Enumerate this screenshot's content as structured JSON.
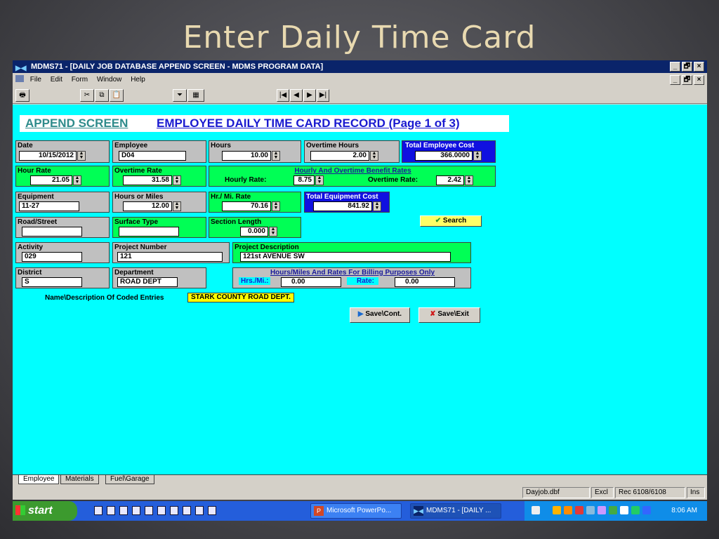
{
  "slide_title": "Enter Daily Time Card",
  "window": {
    "title": "MDMS71 - [DAILY JOB DATABASE APPEND SCREEN - MDMS PROGRAM DATA]",
    "buttons": [
      "_",
      "🗗",
      "×"
    ]
  },
  "menu": [
    "File",
    "Edit",
    "Form",
    "Window",
    "Help"
  ],
  "nav_buttons": [
    "|◀",
    "◀",
    "▶",
    "▶|"
  ],
  "header": {
    "left": "APPEND SCREEN",
    "right": "EMPLOYEE DAILY TIME CARD RECORD (Page 1 of 3)"
  },
  "fields": {
    "date": {
      "label": "Date",
      "value": "10/15/2012"
    },
    "employee": {
      "label": "Employee",
      "value": "D04"
    },
    "hours": {
      "label": "Hours",
      "value": "10.00"
    },
    "overtime_hours": {
      "label": "Overtime Hours",
      "value": "2.00"
    },
    "total_employee_cost": {
      "label": "Total Employee Cost",
      "value": "366.0000"
    },
    "hour_rate": {
      "label": "Hour Rate",
      "value": "21.05"
    },
    "overtime_rate": {
      "label": "Overtime Rate",
      "value": "31.58"
    },
    "benefit": {
      "label": "Hourly And Overtime Benefit Rates",
      "hourly_label": "Hourly Rate:",
      "hourly_value": "8.75",
      "overtime_label": "Overtime Rate:",
      "overtime_value": "2.42"
    },
    "equipment": {
      "label": "Equipment",
      "value": "11-27"
    },
    "hours_or_miles": {
      "label": "Hours or Miles",
      "value": "12.00"
    },
    "hr_mi_rate": {
      "label": "Hr./ Mi. Rate",
      "value": "70.16"
    },
    "total_equipment_cost": {
      "label": "Total Equipment Cost",
      "value": "841.92"
    },
    "road_street": {
      "label": "Road/Street",
      "value": ""
    },
    "surface_type": {
      "label": "Surface Type",
      "value": ""
    },
    "section_length": {
      "label": "Section Length",
      "value": "0.000"
    },
    "activity": {
      "label": "Activity",
      "value": "029"
    },
    "project_number": {
      "label": "Project Number",
      "value": "121"
    },
    "project_description": {
      "label": "Project Description",
      "value": "121st  AVENUE SW"
    },
    "district": {
      "label": "District",
      "value": "S"
    },
    "department": {
      "label": "Department",
      "value": "ROAD DEPT"
    },
    "billing": {
      "label": "Hours/Miles And Rates For Billing Purposes Only",
      "hrs_label": "Hrs./Mi.:",
      "hrs_value": "0.00",
      "rate_label": "Rate:",
      "rate_value": "0.00"
    },
    "coded": {
      "label": "Name\\Description Of Coded Entries",
      "value": "STARK COUNTY ROAD DEPT."
    }
  },
  "buttons": {
    "search": "Search",
    "save_cont": "Save\\Cont.",
    "save_exit": "Save\\Exit"
  },
  "tabs": [
    "Employee",
    "Materials",
    "Fuel\\Garage"
  ],
  "status": {
    "file": "Dayjob.dbf",
    "excl": "Excl",
    "rec": "Rec 6108/6108",
    "ins": "Ins"
  },
  "taskbar": {
    "start": "start",
    "tasks": [
      "Microsoft PowerPo...",
      "MDMS71 - [DAILY ..."
    ],
    "clock": "8:06 AM"
  }
}
